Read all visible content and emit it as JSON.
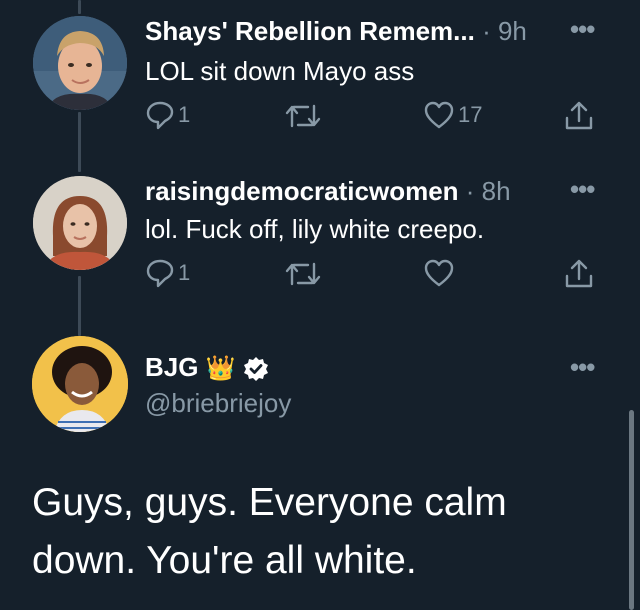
{
  "colors": {
    "background": "#15202b",
    "secondary_text": "#8899a6",
    "primary_text": "#ffffff",
    "thread_line": "#3d4a57"
  },
  "tweets": [
    {
      "name": "Shays' Rebellion Remem...",
      "time": "· 9h",
      "text": "LOL sit down Mayo ass",
      "reply_count": "1",
      "retweet_count": "",
      "like_count": "17",
      "avatar_icon": "avatar-man-icon"
    },
    {
      "name": "raisingdemocraticwomen",
      "time": "· 8h",
      "text": "lol.  Fuck off, lily white creepo.",
      "reply_count": "1",
      "retweet_count": "",
      "like_count": "",
      "avatar_icon": "avatar-woman-icon"
    }
  ],
  "main_tweet": {
    "name": "BJG",
    "emoji": "👑",
    "handle": "@briebriejoy",
    "text": "Guys, guys. Everyone calm down. You're all white."
  }
}
